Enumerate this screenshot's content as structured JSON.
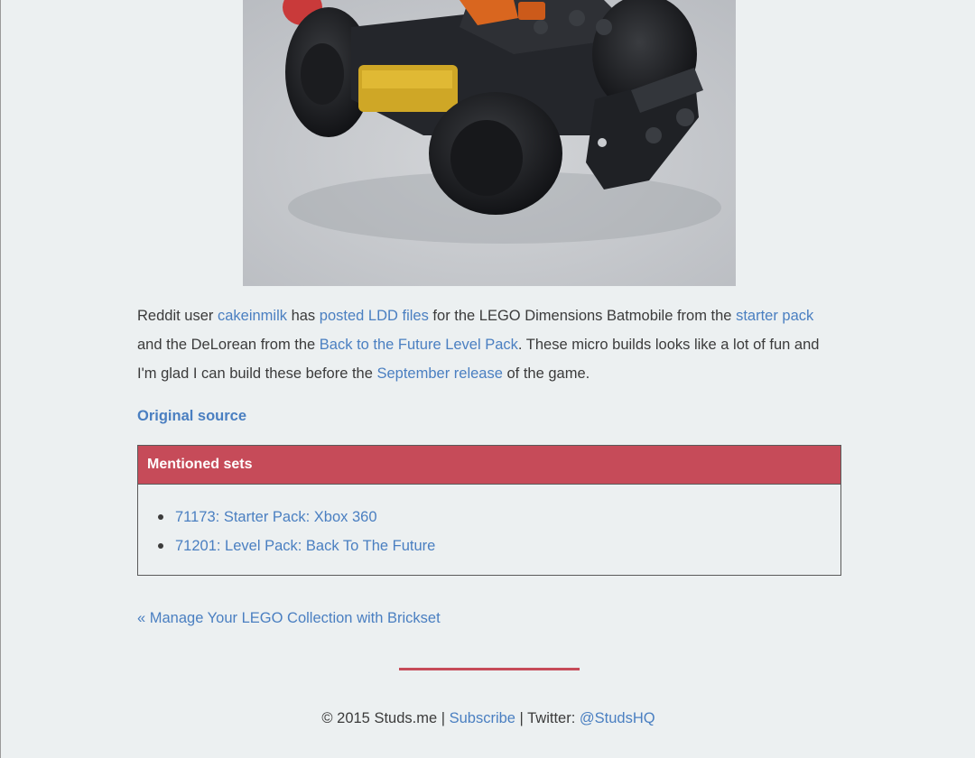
{
  "photo": {
    "alt": "LEGO Dimensions Batmobile micro build"
  },
  "article": {
    "t1": "Reddit user ",
    "link_user": "cakeinmilk",
    "t2": " has ",
    "link_ldd": "posted LDD files",
    "t3": " for the LEGO Dimensions Batmobile from the ",
    "link_starter": "starter pack",
    "t4": " and the DeLorean from the ",
    "link_bttf": "Back to the Future Level Pack",
    "t5": ". These micro builds looks like a lot of fun and I'm glad I can build these before the ",
    "link_release": "September release",
    "t6": " of the game."
  },
  "source": {
    "label": "Original source"
  },
  "sets": {
    "header": "Mentioned sets",
    "items": [
      {
        "label": "71173: Starter Pack: Xbox 360"
      },
      {
        "label": "71201: Level Pack: Back To The Future"
      }
    ]
  },
  "nav": {
    "prev_label": "« Manage Your LEGO Collection with Brickset"
  },
  "footer": {
    "copyright": "© 2015 Studs.me | ",
    "subscribe": "Subscribe",
    "twitter_prefix": " | Twitter: ",
    "twitter_handle": "@StudsHQ"
  },
  "colors": {
    "background": "#ecf0f1",
    "link": "#4a7fc1",
    "accent": "#c64b59",
    "text": "#3b3b3b"
  }
}
